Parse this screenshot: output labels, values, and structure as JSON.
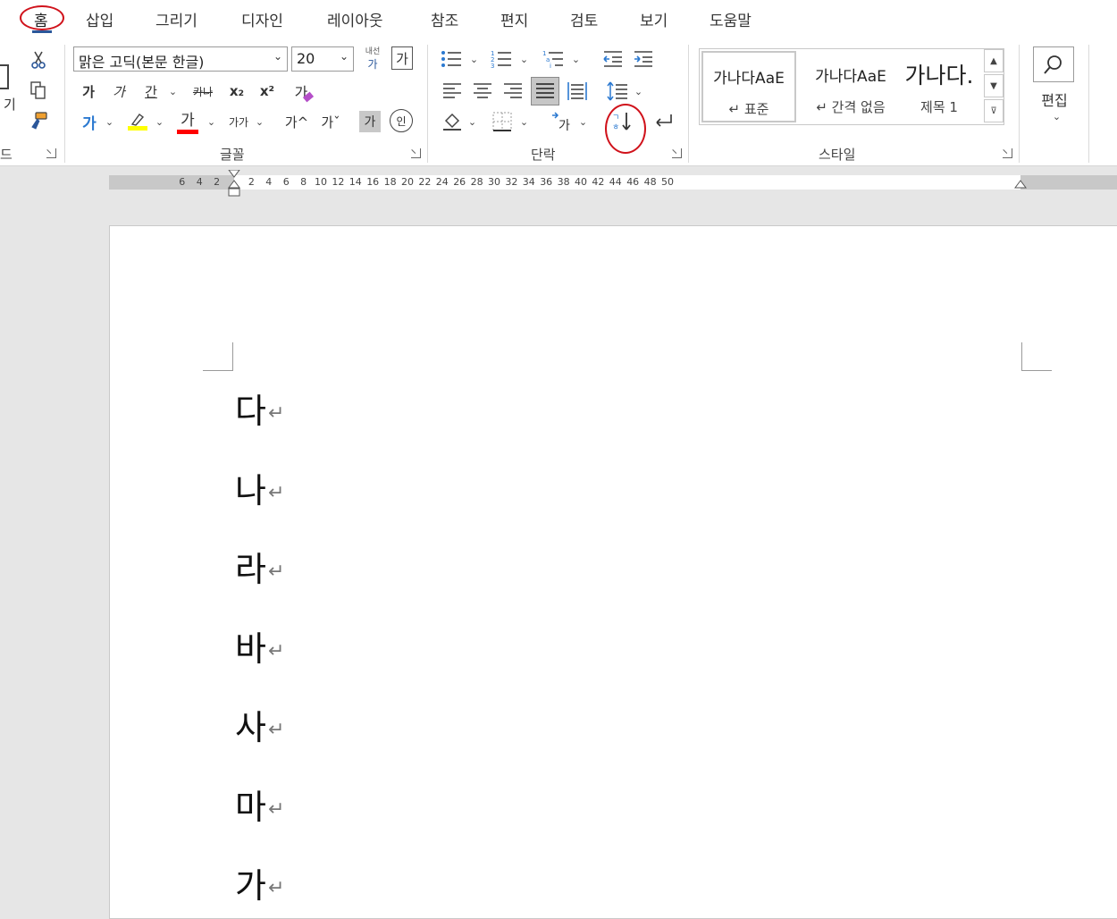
{
  "tabs": [
    {
      "label": "홈",
      "active": true
    },
    {
      "label": "삽입"
    },
    {
      "label": "그리기"
    },
    {
      "label": "디자인"
    },
    {
      "label": "레이아웃"
    },
    {
      "label": "참조"
    },
    {
      "label": "편지"
    },
    {
      "label": "검토"
    },
    {
      "label": "보기"
    },
    {
      "label": "도움말"
    }
  ],
  "clipboard": {
    "paste_label_partial": "기",
    "group_label_partial": "드"
  },
  "font": {
    "name": "맑은 고딕(본문 한글)",
    "size": "20",
    "phonetic_top": "내선",
    "bold": "가",
    "italic": "가",
    "underline": "간",
    "strike": "카나",
    "subscript": "x₂",
    "superscript": "x²",
    "clear_format": "가",
    "text_effect": "가",
    "font_color_glyph": "가",
    "char_case": "가가",
    "grow": "가^",
    "shrink": "가ˇ",
    "char_shade": "가",
    "enclose": "인",
    "char_border": "가",
    "group_label": "글꼴"
  },
  "paragraph": {
    "group_label": "단락",
    "sort_glyph": "↓"
  },
  "styles": {
    "items": [
      {
        "sample": "가나다AaE",
        "name": "↵ 표준"
      },
      {
        "sample": "가나다AaE",
        "name": "↵ 간격 없음"
      },
      {
        "sample": "가나다.",
        "name": "제목 1"
      }
    ],
    "group_label": "스타일"
  },
  "editing": {
    "label": "편집"
  },
  "ruler": {
    "ticks": [
      "6",
      "4",
      "2",
      "2",
      "4",
      "6",
      "8",
      "10",
      "12",
      "14",
      "16",
      "18",
      "20",
      "22",
      "24",
      "26",
      "28",
      "30",
      "32",
      "34",
      "36",
      "38",
      "40",
      "42",
      "44",
      "46",
      "48",
      "50"
    ]
  },
  "document": {
    "paragraphs": [
      "다",
      "나",
      "라",
      "바",
      "사",
      "마",
      "가"
    ],
    "paragraph_mark": "↵"
  },
  "colors": {
    "highlight": "#ffff00",
    "font_color": "#ff0000",
    "annotation": "#d0121b",
    "accent": "#2b579a"
  }
}
